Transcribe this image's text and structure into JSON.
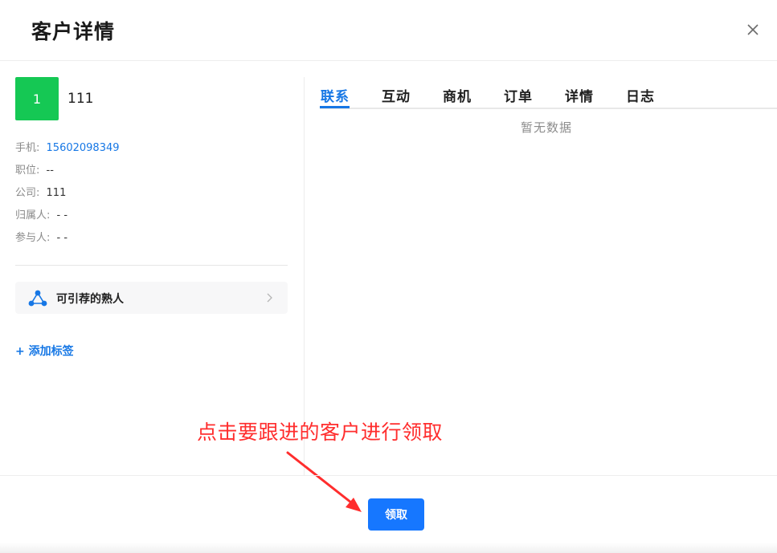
{
  "header": {
    "title": "客户详情",
    "close_icon": "close-icon"
  },
  "customer": {
    "avatar_text": "1",
    "avatar_color": "#15c854",
    "name": "111",
    "fields": [
      {
        "label": "手机:",
        "value": "15602098349",
        "link": true
      },
      {
        "label": "职位:",
        "value": "--"
      },
      {
        "label": "公司:",
        "value": "111"
      },
      {
        "label": "归属人:",
        "value": "- -"
      },
      {
        "label": "参与人:",
        "value": "- -"
      }
    ]
  },
  "referral_card": {
    "label": "可引荐的熟人",
    "icon": "network-share-icon",
    "chevron": "chevron-right-icon"
  },
  "add_tag": {
    "label": "+ 添加标签"
  },
  "tabs": [
    {
      "label": "联系",
      "active": true
    },
    {
      "label": "互动"
    },
    {
      "label": "商机"
    },
    {
      "label": "订单"
    },
    {
      "label": "详情"
    },
    {
      "label": "日志"
    }
  ],
  "empty_text": "暂无数据",
  "footer": {
    "claim_button": "领取"
  },
  "annotation": {
    "text": "点击要跟进的客户进行领取",
    "color": "#ff2d2d"
  },
  "colors": {
    "accent": "#1677ff",
    "link": "#1677e5",
    "annotation": "#ff2d2d"
  }
}
